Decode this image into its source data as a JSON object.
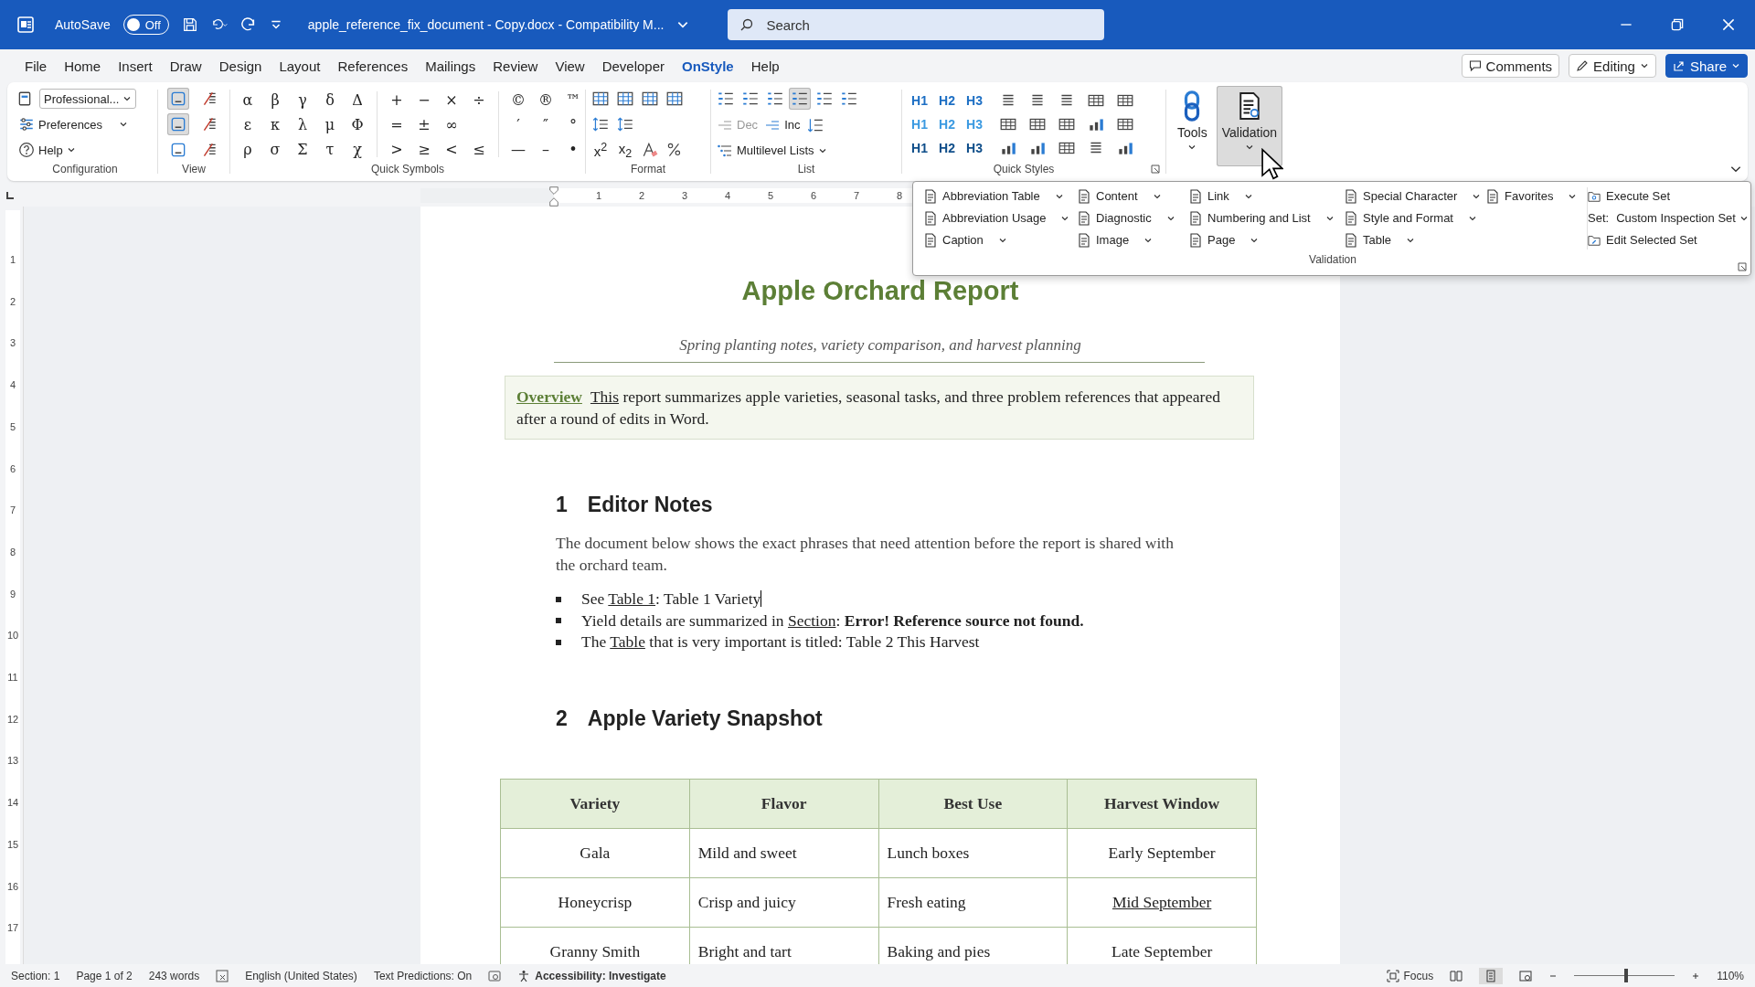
{
  "title_bar": {
    "autosave_label": "AutoSave",
    "autosave_toggle": {
      "label": "Off",
      "on": false
    },
    "document_title": "apple_reference_fix_document - Copy.docx  -  Compatibility M...",
    "search": {
      "placeholder": "Search"
    }
  },
  "menu_tabs": [
    {
      "label": "File",
      "selected": false
    },
    {
      "label": "Home",
      "selected": false
    },
    {
      "label": "Insert",
      "selected": false
    },
    {
      "label": "Draw",
      "selected": false
    },
    {
      "label": "Design",
      "selected": false
    },
    {
      "label": "Layout",
      "selected": false
    },
    {
      "label": "References",
      "selected": false
    },
    {
      "label": "Mailings",
      "selected": false
    },
    {
      "label": "Review",
      "selected": false
    },
    {
      "label": "View",
      "selected": false
    },
    {
      "label": "Developer",
      "selected": false
    },
    {
      "label": "OnStyle",
      "selected": true
    },
    {
      "label": "Help",
      "selected": false
    }
  ],
  "header_buttons": {
    "comments": "Comments",
    "editing": "Editing",
    "share": "Share"
  },
  "ribbon": {
    "configuration": {
      "title": "Configuration",
      "style_dropdown": "Professional...",
      "preferences": "Preferences",
      "help": "Help"
    },
    "view": {
      "title": "View"
    },
    "quick_symbols": {
      "title": "Quick Symbols",
      "sets": [
        [
          [
            "α",
            "β",
            "γ",
            "δ",
            "Δ"
          ],
          [
            "ε",
            "κ",
            "λ",
            "μ",
            "Φ"
          ],
          [
            "ρ",
            "σ",
            "Σ",
            "τ",
            "χ"
          ]
        ],
        [
          [
            "+",
            "−",
            "×",
            "÷"
          ],
          [
            "=",
            "±",
            "∞"
          ],
          [
            ">",
            "≥",
            "<",
            "≤"
          ]
        ],
        [
          [
            "©",
            "®",
            "™"
          ],
          [
            "′",
            "″",
            "°"
          ],
          [
            "—",
            "–",
            "•"
          ]
        ]
      ]
    },
    "format": {
      "title": "Format",
      "superscript": "x$^{2}$",
      "subscript": "x$_{2}$"
    },
    "list": {
      "title": "List",
      "dec": "Dec",
      "inc": "Inc",
      "multilevel": "Multilevel Lists"
    },
    "quick_styles": {
      "title": "Quick Styles",
      "headings": [
        [
          "H1",
          "H2",
          "H3"
        ],
        [
          "H1",
          "H2",
          "H3"
        ],
        [
          "H1",
          "H2",
          "H3"
        ]
      ]
    },
    "tools": {
      "label": "Tools"
    },
    "validation": {
      "label": "Validation",
      "selected": true
    }
  },
  "validation_panel": {
    "title": "Validation",
    "columns": [
      [
        "Abbreviation Table",
        "Abbreviation Usage",
        "Caption"
      ],
      [
        "Content",
        "Diagnostic",
        "Image"
      ],
      [
        "Link",
        "Numbering and List",
        "Page"
      ],
      [
        "Special Character",
        "Style and Format",
        "Table"
      ],
      [
        "Favorites"
      ]
    ],
    "execute": "Execute Set",
    "set_label": "Set:",
    "set_value": "Custom Inspection Set",
    "edit": "Edit Selected Set"
  },
  "ruler": {
    "top_numbers": [
      "1",
      "2",
      "3",
      "4",
      "5",
      "6",
      "7",
      "8"
    ],
    "left_numbers": [
      "1",
      "2",
      "3",
      "4",
      "5",
      "6",
      "7",
      "8",
      "9",
      "10",
      "11",
      "12",
      "13",
      "14",
      "15",
      "16",
      "17"
    ]
  },
  "document": {
    "title": "Apple Orchard Report",
    "subtitle": "Spring planting notes, variety comparison, and harvest planning",
    "overview": [
      {
        "text": "Overview",
        "kind": "label"
      },
      {
        "text": "This",
        "kind": "ref"
      },
      {
        "text": " report summarizes apple varieties, seasonal tasks, and three problem references that appeared after a round of edits in Word.",
        "kind": "plain"
      }
    ],
    "sections": [
      {
        "number": "1",
        "heading": "Editor Notes",
        "paragraph": "The document below shows the exact phrases that need attention before the report is shared with the orchard team.",
        "bullets": [
          [
            {
              "text": "See ",
              "kind": "plain"
            },
            {
              "text": "Table 1",
              "kind": "ref"
            },
            {
              "text": ": Table 1 Variety",
              "kind": "plain"
            }
          ],
          [
            {
              "text": "Yield details are summarized in ",
              "kind": "plain"
            },
            {
              "text": "Section",
              "kind": "ref"
            },
            {
              "text": ": ",
              "kind": "plain"
            },
            {
              "text": "Error! Reference source not found.",
              "kind": "bold"
            }
          ],
          [
            {
              "text": "The ",
              "kind": "plain"
            },
            {
              "text": "Table",
              "kind": "ref"
            },
            {
              "text": " that is very important is titled: Table 2 This Harvest",
              "kind": "plain"
            }
          ]
        ]
      },
      {
        "number": "2",
        "heading": "Apple Variety Snapshot"
      }
    ],
    "table": {
      "columns": [
        "Variety",
        "Flavor",
        "Best Use",
        "Harvest Window"
      ],
      "rows": [
        [
          {
            "text": "Gala",
            "underlined": false
          },
          {
            "text": "Mild and sweet",
            "underlined": false
          },
          {
            "text": "Lunch boxes",
            "underlined": false
          },
          {
            "text": "Early September",
            "underlined": false
          }
        ],
        [
          {
            "text": "Honeycrisp",
            "underlined": false
          },
          {
            "text": "Crisp and juicy",
            "underlined": false
          },
          {
            "text": "Fresh eating",
            "underlined": false
          },
          {
            "text": "Mid September",
            "underlined": true
          }
        ],
        [
          {
            "text": "Granny Smith",
            "underlined": false
          },
          {
            "text": "Bright and tart",
            "underlined": false
          },
          {
            "text": "Baking and pies",
            "underlined": false
          },
          {
            "text": "Late September",
            "underlined": false
          }
        ]
      ]
    }
  },
  "status_bar": {
    "section": "Section: 1",
    "page": "Page 1 of 2",
    "words": "243 words",
    "language": "English (United States)",
    "predictions": "Text Predictions: On",
    "accessibility": "Accessibility: Investigate",
    "focus": "Focus",
    "zoom": {
      "level": 0.52,
      "reading": "110%"
    }
  }
}
